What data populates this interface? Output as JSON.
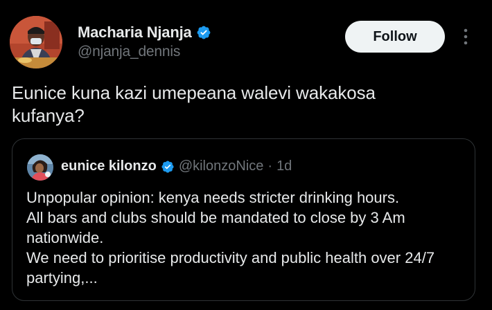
{
  "tweet": {
    "author": {
      "name": "Macharia Njanja",
      "handle": "@njanja_dennis",
      "verified_icon": "verified-badge-icon"
    },
    "follow_label": "Follow",
    "more_icon": "more-vertical-icon",
    "text": "Eunice kuna kazi umepeana walevi wakakosa\nkufanya?"
  },
  "quote": {
    "author": {
      "name": "eunice kilonzo",
      "handle": "@kilonzoNice",
      "separator": "·",
      "time": "1d",
      "verified_icon": "verified-badge-icon"
    },
    "text": "Unpopular opinion: kenya needs stricter drinking hours.\nAll bars and clubs should be mandated to close by 3 Am\nnationwide.\nWe need to prioritise productivity and public health over 24/7\npartying,..."
  },
  "colors": {
    "background": "#000000",
    "primary_text": "#e7e9ea",
    "secondary_text": "#71767b",
    "verified": "#1d9bf0",
    "border": "#2f3336",
    "follow_button_bg": "#eff3f4"
  }
}
